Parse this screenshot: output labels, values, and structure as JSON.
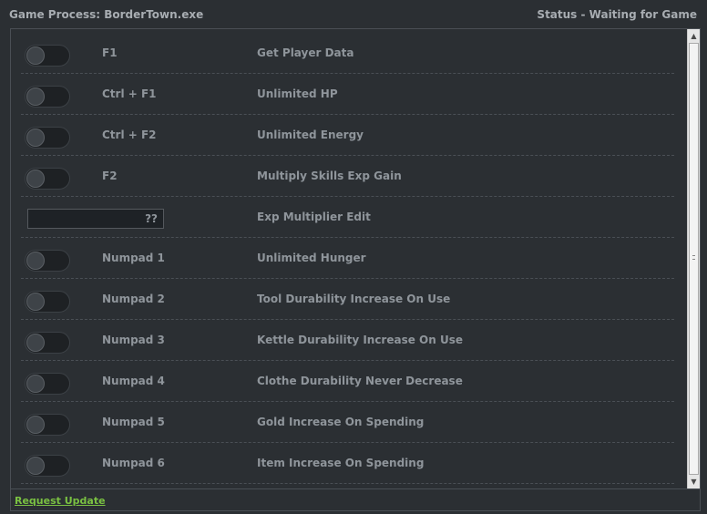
{
  "header": {
    "process": "Game Process: BorderTown.exe",
    "status": "Status - Waiting for Game"
  },
  "rows": [
    {
      "type": "toggle",
      "hotkey": "F1",
      "label": "Get Player Data",
      "enabled": false
    },
    {
      "type": "toggle",
      "hotkey": "Ctrl + F1",
      "label": "Unlimited HP",
      "enabled": false
    },
    {
      "type": "toggle",
      "hotkey": "Ctrl + F2",
      "label": "Unlimited Energy",
      "enabled": false
    },
    {
      "type": "toggle",
      "hotkey": "F2",
      "label": "Multiply Skills Exp Gain",
      "enabled": false
    },
    {
      "type": "edit",
      "value": "??",
      "label": "Exp Multiplier Edit"
    },
    {
      "type": "toggle",
      "hotkey": "Numpad 1",
      "label": "Unlimited Hunger",
      "enabled": false
    },
    {
      "type": "toggle",
      "hotkey": "Numpad 2",
      "label": "Tool Durability Increase On Use",
      "enabled": false
    },
    {
      "type": "toggle",
      "hotkey": "Numpad 3",
      "label": "Kettle Durability Increase On Use",
      "enabled": false
    },
    {
      "type": "toggle",
      "hotkey": "Numpad 4",
      "label": "Clothe Durability Never Decrease",
      "enabled": false
    },
    {
      "type": "toggle",
      "hotkey": "Numpad 5",
      "label": "Gold Increase On Spending",
      "enabled": false
    },
    {
      "type": "toggle",
      "hotkey": "Numpad 6",
      "label": "Item Increase On Spending",
      "enabled": false
    }
  ],
  "scrollbar": {
    "up_glyph": "▲",
    "down_glyph": "▼"
  },
  "footer": {
    "link": "Request Update"
  },
  "colors": {
    "background": "#2b2f33",
    "link": "#7ac142",
    "text": "#8f959b"
  }
}
